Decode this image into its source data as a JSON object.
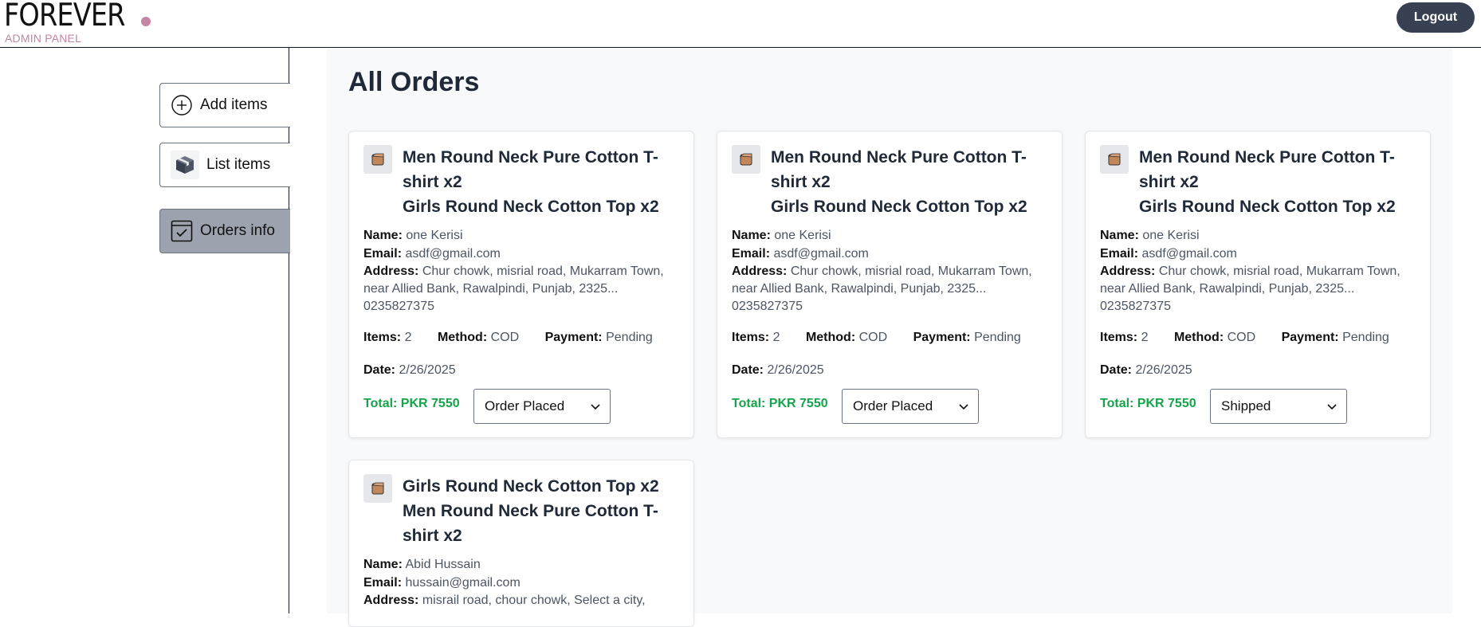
{
  "header": {
    "logo_text": "FOREVER",
    "logo_sub": "ADMIN PANEL",
    "logout_label": "Logout"
  },
  "sidebar": {
    "items": [
      {
        "label": "Add items",
        "icon": "add-circle-icon"
      },
      {
        "label": "List items",
        "icon": "box-icon"
      },
      {
        "label": "Orders info",
        "icon": "checkbox-icon",
        "active": true
      }
    ]
  },
  "main": {
    "title": "All Orders",
    "labels": {
      "name": "Name:",
      "email": "Email:",
      "address": "Address:",
      "items": "Items:",
      "method": "Method:",
      "payment": "Payment:",
      "date": "Date:"
    },
    "orders": [
      {
        "items": [
          "Men Round Neck Pure Cotton T-shirt x2",
          "Girls Round Neck Cotton Top x2"
        ],
        "name": "one Kerisi",
        "email": "asdf@gmail.com",
        "address": "Chur chowk, misrial road, Mukarram Town, near Allied Bank, Rawalpindi, Punjab, 2325...",
        "phone": "0235827375",
        "item_count": "2",
        "method": "COD",
        "payment": "Pending",
        "date": "2/26/2025",
        "total": "Total: PKR 7550",
        "status": "Order Placed"
      },
      {
        "items": [
          "Men Round Neck Pure Cotton T-shirt x2",
          "Girls Round Neck Cotton Top x2"
        ],
        "name": "one Kerisi",
        "email": "asdf@gmail.com",
        "address": "Chur chowk, misrial road, Mukarram Town, near Allied Bank, Rawalpindi, Punjab, 2325...",
        "phone": "0235827375",
        "item_count": "2",
        "method": "COD",
        "payment": "Pending",
        "date": "2/26/2025",
        "total": "Total: PKR 7550",
        "status": "Order Placed"
      },
      {
        "items": [
          "Men Round Neck Pure Cotton T-shirt x2",
          "Girls Round Neck Cotton Top x2"
        ],
        "name": "one Kerisi",
        "email": "asdf@gmail.com",
        "address": "Chur chowk, misrial road, Mukarram Town, near Allied Bank, Rawalpindi, Punjab, 2325...",
        "phone": "0235827375",
        "item_count": "2",
        "method": "COD",
        "payment": "Pending",
        "date": "2/26/2025",
        "total": "Total: PKR 7550",
        "status": "Shipped"
      },
      {
        "items": [
          "Girls Round Neck Cotton Top x2",
          "Men Round Neck Pure Cotton T-shirt x2"
        ],
        "name": "Abid Hussain",
        "email": "hussain@gmail.com",
        "address": "misrail road, chour chowk, Select a city,"
      }
    ]
  }
}
